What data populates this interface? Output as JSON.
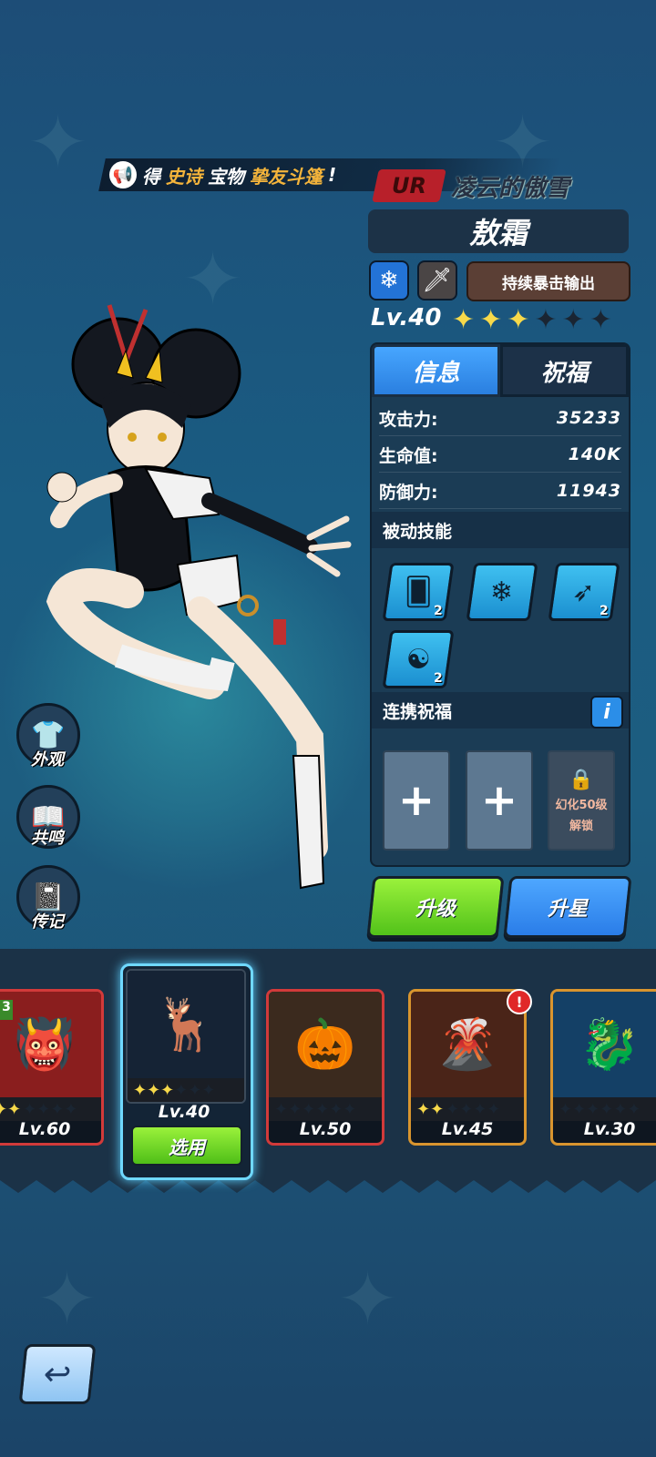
{
  "broadcast": {
    "prefix": "得",
    "highlight1": "史诗",
    "middle": "宝物",
    "highlight2": "挚友斗篷",
    "suffix": "!"
  },
  "hero": {
    "rarity": "UR",
    "title": "凌云的傲雪",
    "name": "敖霜",
    "element_icon": "snowflake-icon",
    "weapon_icon": "sword-icon",
    "role": "持续暴击输出",
    "level": "Lv.40",
    "stars_filled": 3,
    "stars_total": 6
  },
  "tabs": [
    {
      "label": "信息",
      "active": true
    },
    {
      "label": "祝福",
      "active": false
    }
  ],
  "stats": [
    {
      "label": "攻击力:",
      "value": "35233"
    },
    {
      "label": "生命值:",
      "value": "140K"
    },
    {
      "label": "防御力:",
      "value": "11943"
    }
  ],
  "passive": {
    "header": "被动技能",
    "skills": [
      {
        "icon": "cards-icon",
        "count": "2"
      },
      {
        "icon": "snowflake-icon",
        "count": ""
      },
      {
        "icon": "claw-icon",
        "count": "2"
      },
      {
        "icon": "dragon-icon",
        "count": "2"
      }
    ]
  },
  "link_blessing": {
    "header": "连携祝福",
    "info": "i",
    "slots": [
      "+",
      "+"
    ],
    "locked": {
      "line1": "幻化50级",
      "line2": "解锁"
    }
  },
  "actions": {
    "upgrade": "升级",
    "star_up": "升星"
  },
  "side_menu": [
    {
      "label": "外观",
      "icon": "shirt-icon"
    },
    {
      "label": "共鸣",
      "icon": "book-icon"
    },
    {
      "label": "传记",
      "icon": "journal-icon"
    }
  ],
  "roster": [
    {
      "level": "Lv.60",
      "stars": 2,
      "border": "#d23a3a",
      "bg": "#8a1e1e",
      "icon": "demon-icon",
      "badge": "3"
    },
    {
      "level": "Lv.40",
      "stars": 3,
      "selected": true,
      "icon": "deer-icon",
      "action": "选用"
    },
    {
      "level": "Lv.50",
      "stars": 0,
      "border": "#d23a3a",
      "bg": "#3b2a1e",
      "icon": "pumpkin-icon"
    },
    {
      "level": "Lv.45",
      "stars": 2,
      "border": "#d9952e",
      "bg": "#4a2418",
      "icon": "lava-icon",
      "alert": "!"
    },
    {
      "level": "Lv.30",
      "stars": 0,
      "border": "#d9952e",
      "bg": "#144066",
      "icon": "ice-monster-icon"
    }
  ],
  "colors": {
    "accent_blue": "#2a7fe0",
    "accent_green": "#52c21a",
    "star_gold": "#f7d94a",
    "rarity_red": "#b8202a"
  }
}
